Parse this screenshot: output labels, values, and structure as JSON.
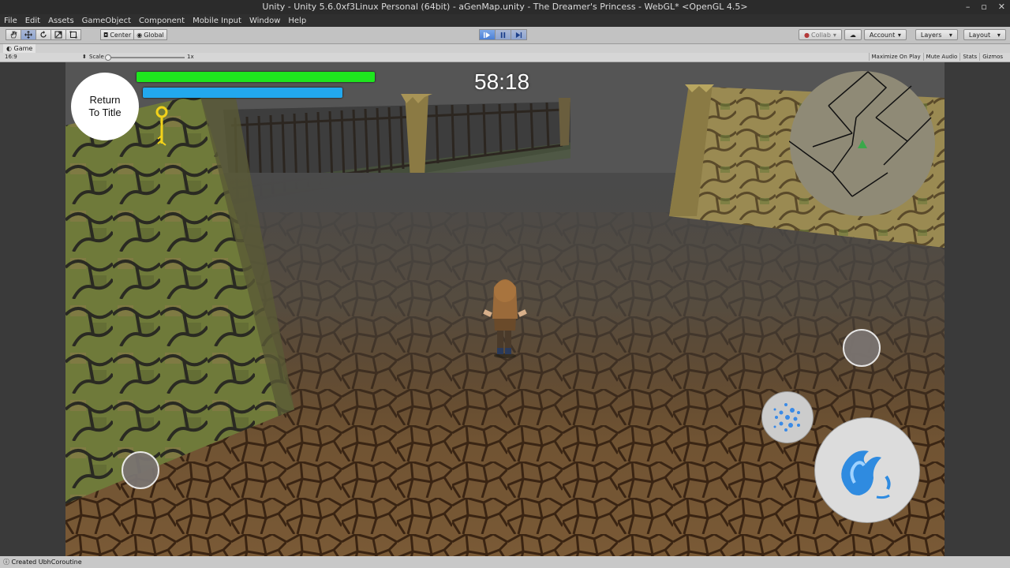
{
  "window": {
    "title": "Unity - Unity 5.6.0xf3Linux Personal (64bit) - aGenMap.unity - The Dreamer's Princess - WebGL* <OpenGL 4.5>",
    "controls": [
      "–",
      "▫",
      "✕"
    ]
  },
  "menu": {
    "items": [
      "File",
      "Edit",
      "Assets",
      "GameObject",
      "Component",
      "Mobile Input",
      "Window",
      "Help"
    ]
  },
  "toolbar": {
    "tools": [
      "hand-tool",
      "move-tool",
      "rotate-tool",
      "scale-tool",
      "rect-tool"
    ],
    "pivot_label": "Center",
    "space_label": "Global",
    "collab_label": "Collab",
    "account_label": "Account",
    "layers_label": "Layers",
    "layout_label": "Layout"
  },
  "game_view": {
    "tab_label": "Game",
    "aspect_label": "16:9",
    "scale_label": "Scale",
    "scale_value": "1x",
    "options": [
      "Maximize On Play",
      "Mute Audio",
      "Stats",
      "Gizmos"
    ]
  },
  "hud": {
    "return_button_label": "Return\nTo Title",
    "timer": "58:18",
    "health_level": 1.0,
    "mana_level": 1.0,
    "colors": {
      "health": "#1ee61e",
      "mana": "#22a8ee",
      "key": "#f2d21a"
    },
    "icons": [
      "key-icon",
      "minimap-player-arrow-icon",
      "water-swirl-icon",
      "water-drop-icon"
    ]
  },
  "status": {
    "message": "Created UbhCoroutine"
  }
}
